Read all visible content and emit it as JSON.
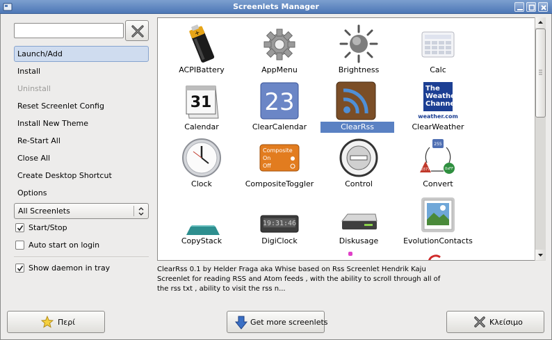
{
  "window": {
    "title": "Screenlets Manager"
  },
  "search": {
    "value": "",
    "placeholder": ""
  },
  "menu": {
    "items": [
      {
        "label": "Launch/Add",
        "state": "selected"
      },
      {
        "label": "Install",
        "state": "normal"
      },
      {
        "label": "Uninstall",
        "state": "disabled"
      },
      {
        "label": "Reset Screenlet Config",
        "state": "normal"
      },
      {
        "label": "Install New Theme",
        "state": "normal"
      },
      {
        "label": "Re-Start All",
        "state": "normal"
      },
      {
        "label": "Close All",
        "state": "normal"
      },
      {
        "label": "Create Desktop Shortcut",
        "state": "normal"
      },
      {
        "label": "Options",
        "state": "normal"
      }
    ]
  },
  "filter": {
    "selected": "All Screenlets"
  },
  "checks": {
    "start_stop": {
      "label": "Start/Stop",
      "checked": true
    },
    "auto_start": {
      "label": "Auto start on login",
      "checked": false
    },
    "daemon_tray": {
      "label": "Show daemon in tray",
      "checked": true
    }
  },
  "screenlets": [
    {
      "name": "ACPIBattery",
      "icon": "battery-icon"
    },
    {
      "name": "AppMenu",
      "icon": "gear-icon"
    },
    {
      "name": "Brightness",
      "icon": "sun-icon"
    },
    {
      "name": "Calc",
      "icon": "calculator-icon"
    },
    {
      "name": "Calendar",
      "icon": "calendar-icon",
      "text": "31"
    },
    {
      "name": "ClearCalendar",
      "icon": "clear-calendar-icon",
      "text": "23"
    },
    {
      "name": "ClearRss",
      "icon": "rss-icon",
      "selected": true
    },
    {
      "name": "ClearWeather",
      "icon": "weather-channel-icon",
      "text": [
        "The",
        "Weather",
        "Channel",
        "weather.com"
      ]
    },
    {
      "name": "Clock",
      "icon": "clock-icon"
    },
    {
      "name": "CompositeToggler",
      "icon": "composite-toggler-icon",
      "text": [
        "Composite",
        "On",
        "Off"
      ]
    },
    {
      "name": "Control",
      "icon": "control-icon"
    },
    {
      "name": "Convert",
      "icon": "convert-icon",
      "text": [
        "255",
        "0377",
        "0xFF"
      ]
    },
    {
      "name": "CopyStack",
      "icon": "copystack-icon"
    },
    {
      "name": "DigiClock",
      "icon": "digital-clock-icon",
      "text": "19:31:46"
    },
    {
      "name": "Diskusage",
      "icon": "disk-icon"
    },
    {
      "name": "EvolutionContacts",
      "icon": "contacts-icon"
    }
  ],
  "description": "ClearRss 0.1 by Helder Fraga aka Whise based on Rss Screenlet Hendrik Kaju Screenlet for reading RSS and Atom feeds , with the ability to scroll through all of the rss txt , ability to visit the rss n...",
  "buttons": {
    "about": "Περί",
    "get_more": "Get more screenlets",
    "close": "Κλείσιμο"
  },
  "colors": {
    "titlebar": "#5b82bd",
    "selection": "#5a81c3",
    "rss": "#8a5a2e"
  }
}
